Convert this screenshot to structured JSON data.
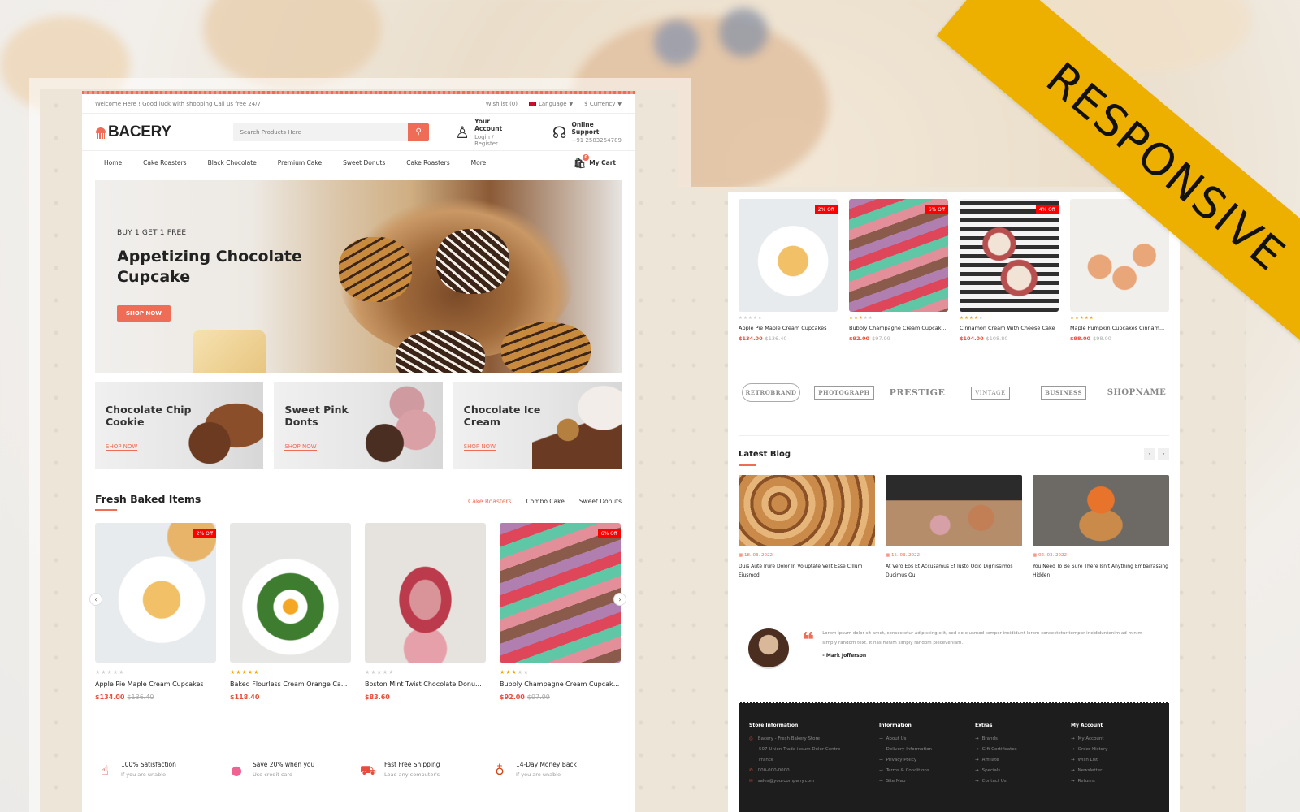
{
  "ribbon": "RESPONSIVE",
  "desktop": {
    "topbar": {
      "welcome": "Welcome Here ! Good luck with shopping Call us free 24/7",
      "wishlist": "Wishlist (0)",
      "language": "Language",
      "currency": "$ Currency"
    },
    "header": {
      "logo": "BACERY",
      "search_placeholder": "Search Products Here",
      "account_title": "Your Account",
      "account_sub": "Login / Register",
      "support_title": "Online Support",
      "support_phone": "+91 2583254789"
    },
    "nav": {
      "items": [
        "Home",
        "Cake Roasters",
        "Black Chocolate",
        "Premium Cake",
        "Sweet Donuts",
        "Cake Roasters",
        "More"
      ],
      "cart_label": "My Cart",
      "cart_count": "0"
    },
    "hero": {
      "subtitle": "BUY 1 GET 1 FREE",
      "title": "Appetizing Chocolate Cupcake",
      "button": "SHOP NOW"
    },
    "promos": [
      {
        "title": "Chocolate Chip Cookie",
        "link": "SHOP NOW"
      },
      {
        "title": "Sweet Pink Donts",
        "link": "SHOP NOW"
      },
      {
        "title": "Chocolate Ice Cream",
        "link": "SHOP NOW"
      }
    ],
    "fresh": {
      "title": "Fresh Baked Items",
      "tabs": [
        "Cake Roasters",
        "Combo Cake",
        "Sweet Donuts"
      ],
      "active_tab": "Cake Roasters",
      "products": [
        {
          "name": "Apple Pie Maple Cream Cupcakes",
          "price": "$134.00",
          "old_price": "$136.40",
          "rating": 0,
          "badge": "2% Off"
        },
        {
          "name": "Baked Flourless Cream Orange Ca...",
          "price": "$118.40",
          "old_price": "",
          "rating": 5,
          "badge": ""
        },
        {
          "name": "Boston Mint Twist Chocolate Donu...",
          "price": "$83.60",
          "old_price": "",
          "rating": 0,
          "badge": ""
        },
        {
          "name": "Bubbly Champagne Cream Cupcak...",
          "price": "$92.00",
          "old_price": "$97.99",
          "rating": 3,
          "badge": "6% Off"
        }
      ]
    },
    "features": [
      {
        "icon": "stars-hand-icon",
        "title": "100% Satisfaction",
        "sub": "If you are unable"
      },
      {
        "icon": "piggy-bank-icon",
        "title": "Save 20% when you",
        "sub": "Use credit card"
      },
      {
        "icon": "delivery-scooter-icon",
        "title": "Fast Free Shipping",
        "sub": "Load any computer's"
      },
      {
        "icon": "money-bag-icon",
        "title": "14-Day Money Back",
        "sub": "If you are unable"
      }
    ]
  },
  "tablet": {
    "products": [
      {
        "name": "Apple Pie Maple Cream Cupcakes",
        "price": "$134.00",
        "old_price": "$136.40",
        "rating": 0,
        "badge": "2% Off"
      },
      {
        "name": "Bubbly Champagne Cream Cupcak...",
        "price": "$92.00",
        "old_price": "$97.99",
        "rating": 3,
        "badge": "6% Off"
      },
      {
        "name": "Cinnamon Cream With Cheese Cake",
        "price": "$104.00",
        "old_price": "$108.80",
        "rating": 4,
        "badge": "4% Off"
      },
      {
        "name": "Maple Pumpkin Cupcakes Cinnam...",
        "price": "$98.00",
        "old_price": "$98.00",
        "rating": 5,
        "badge": ""
      }
    ],
    "brands": [
      "RETROBRAND",
      "PHOTOGRAPH",
      "PRESTIGE",
      "VINTAGE",
      "BUSINESS",
      "SHOPNAME"
    ],
    "blog": {
      "title": "Latest Blog",
      "posts": [
        {
          "date": "18. 03. 2022",
          "title": "Duis Aute Irure Dolor In Voluptate Velit Esse Cillum Eiusmod"
        },
        {
          "date": "15. 03. 2022",
          "title": "At Vero Eos Et Accusamus Et Iusto Odio Dignissimos Ducimus Qui"
        },
        {
          "date": "02. 03. 2022",
          "title": "You Need To Be Sure There Isn't Anything Embarrassing Hidden"
        }
      ]
    },
    "testimonial": {
      "text": "Lorem ipsum dolor sit amet, consectetur adipiscing elit, sed do eiusmod tempor incididunt lorem consectetur tempor incididuntenim ad minim simply random text. It has minim simply random pieceveniam.",
      "author": "- Mark Jofferson"
    },
    "footer": {
      "store": {
        "title": "Store Information",
        "name": "Bacery - Fresh Bakery Store",
        "address1": "507-Union Trade ipsum Doler Centre",
        "address2": "France",
        "phone": "000-000-0000",
        "email": "sales@yourcompany.com"
      },
      "columns": [
        {
          "title": "Information",
          "links": [
            "About Us",
            "Delivery Information",
            "Privacy Policy",
            "Terms & Conditions",
            "Site Map"
          ]
        },
        {
          "title": "Extras",
          "links": [
            "Brands",
            "Gift Certificates",
            "Affiliate",
            "Specials",
            "Contact Us"
          ]
        },
        {
          "title": "My Account",
          "links": [
            "My Account",
            "Order History",
            "Wish List",
            "Newsletter",
            "Returns"
          ]
        }
      ]
    }
  }
}
